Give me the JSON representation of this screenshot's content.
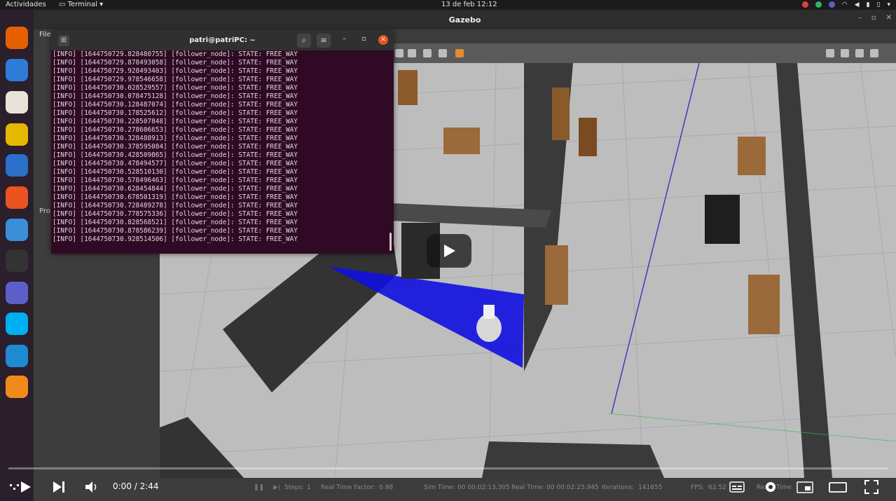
{
  "topbar": {
    "activities": "Actividades",
    "app_menu": "Terminal",
    "clock": "13 de feb  12:12"
  },
  "dock": {
    "items": [
      {
        "name": "firefox-icon",
        "color": "#e66000"
      },
      {
        "name": "thunderbird-icon",
        "color": "#2f7bd8"
      },
      {
        "name": "files-icon",
        "color": "#e8e3d9"
      },
      {
        "name": "rhythmbox-icon",
        "color": "#e5b800"
      },
      {
        "name": "writer-icon",
        "color": "#2a6fc9"
      },
      {
        "name": "software-icon",
        "color": "#e95420"
      },
      {
        "name": "help-icon",
        "color": "#3a8fd8"
      },
      {
        "name": "terminal-icon",
        "color": "#333333"
      },
      {
        "name": "teams-icon",
        "color": "#5b5fc7"
      },
      {
        "name": "skype-icon",
        "color": "#00aff0"
      },
      {
        "name": "vscode-icon",
        "color": "#1f8ad2"
      },
      {
        "name": "sublime-icon",
        "color": "#f08a1d"
      }
    ]
  },
  "gazebo": {
    "title": "Gazebo",
    "menu_file": "File",
    "left_panel_label": "Pro",
    "bottom": {
      "steps_label": "Steps:",
      "steps_value": "1",
      "rtf_label": "Real Time Factor:",
      "rtf_value": "0.98",
      "sim_label": "Sim Time:",
      "sim_value": "00 00:02:13.305",
      "real_label": "Real Time:",
      "real_value": "00 00:02:25.945",
      "iter_label": "Iterations:",
      "iter_value": "141655",
      "fps_label": "FPS:",
      "fps_value": "62.52",
      "reset_label": "Reset Time"
    }
  },
  "terminal": {
    "title": "patri@patriPC: ~",
    "lines": [
      "[INFO] [1644750729.828480755] [follower_node]: STATE: FREE_WAY",
      "[INFO] [1644750729.878493058] [follower_node]: STATE: FREE_WAY",
      "[INFO] [1644750729.928493403] [follower_node]: STATE: FREE_WAY",
      "[INFO] [1644750729.978546658] [follower_node]: STATE: FREE_WAY",
      "[INFO] [1644750730.028529557] [follower_node]: STATE: FREE_WAY",
      "[INFO] [1644750730.078475128] [follower_node]: STATE: FREE_WAY",
      "[INFO] [1644750730.128487074] [follower_node]: STATE: FREE_WAY",
      "[INFO] [1644750730.178525612] [follower_node]: STATE: FREE_WAY",
      "[INFO] [1644750730.228507848] [follower_node]: STATE: FREE_WAY",
      "[INFO] [1644750730.278606653] [follower_node]: STATE: FREE_WAY",
      "[INFO] [1644750730.328488913] [follower_node]: STATE: FREE_WAY",
      "[INFO] [1644750730.378595084] [follower_node]: STATE: FREE_WAY",
      "[INFO] [1644750730.428509865] [follower_node]: STATE: FREE_WAY",
      "[INFO] [1644750730.478494577] [follower_node]: STATE: FREE_WAY",
      "[INFO] [1644750730.528510130] [follower_node]: STATE: FREE_WAY",
      "[INFO] [1644750730.578496463] [follower_node]: STATE: FREE_WAY",
      "[INFO] [1644750730.628454844] [follower_node]: STATE: FREE_WAY",
      "[INFO] [1644750730.678501319] [follower_node]: STATE: FREE_WAY",
      "[INFO] [1644750730.728489278] [follower_node]: STATE: FREE_WAY",
      "[INFO] [1644750730.778575336] [follower_node]: STATE: FREE_WAY",
      "[INFO] [1644750730.828568521] [follower_node]: STATE: FREE_WAY",
      "[INFO] [1644750730.878586239] [follower_node]: STATE: FREE_WAY",
      "[INFO] [1644750730.928514506] [follower_node]: STATE: FREE_WAY"
    ]
  },
  "video": {
    "time": "0:00 / 2:44",
    "progress": 0
  }
}
